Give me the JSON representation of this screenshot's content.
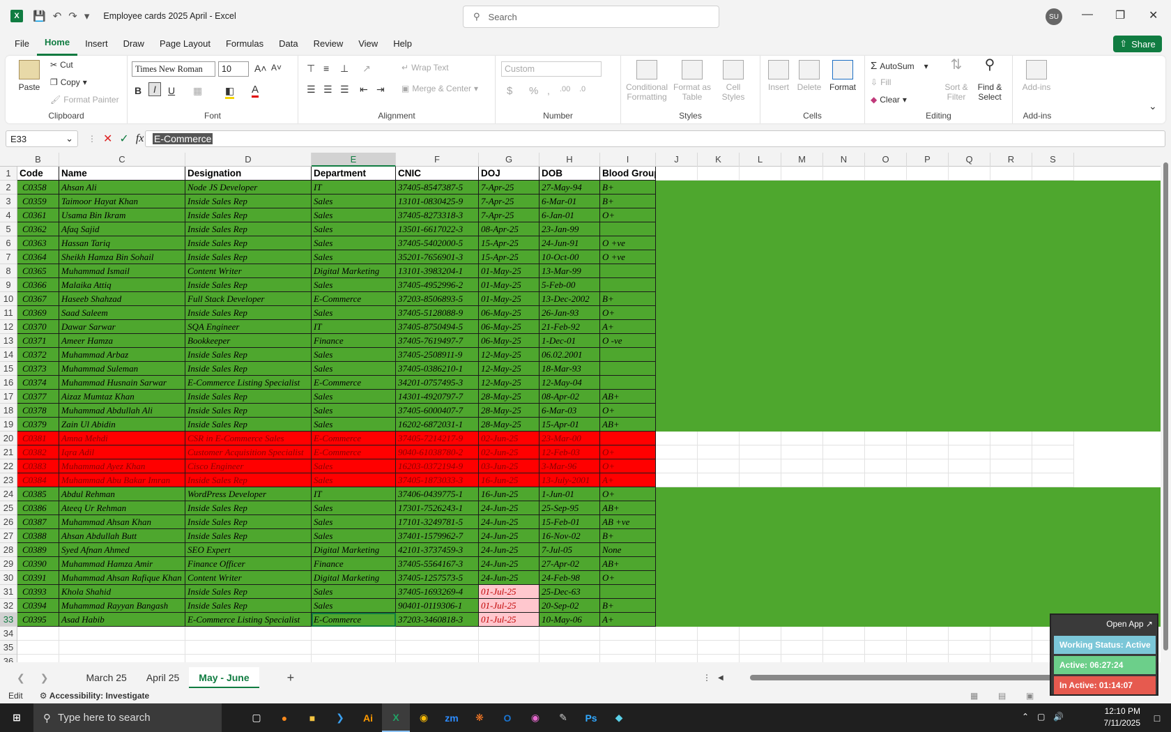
{
  "window": {
    "title": "Employee cards 2025 April  -  Excel",
    "search_placeholder": "Search",
    "avatar": "SU"
  },
  "menu": {
    "items": [
      "File",
      "Home",
      "Insert",
      "Draw",
      "Page Layout",
      "Formulas",
      "Data",
      "Review",
      "View",
      "Help"
    ],
    "share": "Share"
  },
  "ribbon": {
    "clipboard": {
      "paste": "Paste",
      "cut": "Cut",
      "copy": "Copy",
      "format_painter": "Format Painter",
      "label": "Clipboard"
    },
    "font": {
      "name": "Times New Roman",
      "size": "10",
      "label": "Font"
    },
    "alignment": {
      "wrap": "Wrap Text",
      "merge": "Merge & Center",
      "label": "Alignment"
    },
    "number": {
      "format": "Custom",
      "label": "Number"
    },
    "styles": {
      "cond": "Conditional Formatting",
      "table": "Format as Table",
      "cell": "Cell Styles",
      "label": "Styles"
    },
    "cells": {
      "insert": "Insert",
      "delete": "Delete",
      "format": "Format",
      "label": "Cells"
    },
    "editing": {
      "autosum": "AutoSum",
      "fill": "Fill",
      "clear": "Clear",
      "sort": "Sort & Filter",
      "find": "Find & Select",
      "label": "Editing"
    },
    "addins": {
      "btn": "Add-ins",
      "label": "Add-ins"
    }
  },
  "formula": {
    "namebox": "E33",
    "fx": "fx",
    "value": "E-Commerce"
  },
  "grid": {
    "columns": [
      "B",
      "C",
      "D",
      "E",
      "F",
      "G",
      "H",
      "I",
      "J",
      "K",
      "L",
      "M",
      "N",
      "O",
      "P",
      "Q",
      "R",
      "S"
    ],
    "headers": [
      "Code",
      "Name",
      "Designation",
      "Department",
      "CNIC",
      "DOJ",
      "DOB",
      "Blood Group"
    ],
    "rows": [
      [
        "C0358",
        "Ahsan Ali",
        "Node JS Developer",
        "IT",
        "37405-8547387-5",
        "7-Apr-25",
        "27-May-94",
        "B+"
      ],
      [
        "C0359",
        "Taimoor Hayat Khan",
        "Inside Sales Rep",
        "Sales",
        "13101-0830425-9",
        "7-Apr-25",
        "6-Mar-01",
        "B+"
      ],
      [
        "C0361",
        "Usama Bin Ikram",
        "Inside Sales Rep",
        "Sales",
        "37405-8273318-3",
        "7-Apr-25",
        "6-Jan-01",
        "O+"
      ],
      [
        "C0362",
        "Afaq Sajid",
        "Inside Sales Rep",
        "Sales",
        "13501-6617022-3",
        "08-Apr-25",
        "23-Jan-99",
        ""
      ],
      [
        "C0363",
        "Hassan Tariq",
        "Inside Sales Rep",
        "Sales",
        "37405-5402000-5",
        "15-Apr-25",
        "24-Jun-91",
        "O +ve"
      ],
      [
        "C0364",
        "Sheikh Hamza Bin Sohail",
        "Inside Sales Rep",
        "Sales",
        "35201-7656901-3",
        "15-Apr-25",
        "10-Oct-00",
        "O +ve"
      ],
      [
        "C0365",
        "Muhammad Ismail",
        "Content Writer",
        "Digital Marketing",
        "13101-3983204-1",
        "01-May-25",
        "13-Mar-99",
        ""
      ],
      [
        "C0366",
        "Malaika Attiq",
        "Inside Sales Rep",
        "Sales",
        "37405-4952996-2",
        "01-May-25",
        "5-Feb-00",
        ""
      ],
      [
        "C0367",
        "Haseeb Shahzad",
        "Full Stack Developer",
        "E-Commerce",
        "37203-8506893-5",
        "01-May-25",
        "13-Dec-2002",
        "B+"
      ],
      [
        "C0369",
        "Saad Saleem",
        "Inside Sales Rep",
        "Sales",
        "37405-5128088-9",
        "06-May-25",
        "26-Jan-93",
        "O+"
      ],
      [
        "C0370",
        "Dawar Sarwar",
        "SQA Engineer",
        "IT",
        "37405-8750494-5",
        "06-May-25",
        "21-Feb-92",
        "A+"
      ],
      [
        "C0371",
        "Ameer Hamza",
        "Bookkeeper",
        "Finance",
        "37405-7619497-7",
        "06-May-25",
        "1-Dec-01",
        "O -ve"
      ],
      [
        "C0372",
        "Muhammad Arbaz",
        "Inside Sales Rep",
        "Sales",
        "37405-2508911-9",
        "12-May-25",
        "06.02.2001",
        ""
      ],
      [
        "C0373",
        "Muhammad Suleman",
        "Inside Sales Rep",
        "Sales",
        "37405-0386210-1",
        "12-May-25",
        "18-Mar-93",
        ""
      ],
      [
        "C0374",
        "Muhammad Husnain Sarwar",
        "E-Commerce Listing Specialist",
        "E-Commerce",
        "34201-0757495-3",
        "12-May-25",
        "12-May-04",
        ""
      ],
      [
        "C0377",
        "Aizaz Mumtaz Khan",
        "Inside Sales Rep",
        "Sales",
        "14301-4920797-7",
        "28-May-25",
        "08-Apr-02",
        "AB+"
      ],
      [
        "C0378",
        "Muhammad Abdullah Ali",
        "Inside Sales Rep",
        "Sales",
        "37405-6000407-7",
        "28-May-25",
        "6-Mar-03",
        "O+"
      ],
      [
        "C0379",
        "Zain Ul Abidin",
        "Inside Sales Rep",
        "Sales",
        "16202-6872031-1",
        "28-May-25",
        "15-Apr-01",
        "AB+"
      ],
      [
        "C0381",
        "Amna Mehdi",
        "CSR in E-Commerce Sales",
        "E-Commerce",
        "37405-7214217-9",
        "02-Jun-25",
        "23-Mar-00",
        ""
      ],
      [
        "C0382",
        "Iqra Adil",
        "Customer Acquisition Specialist",
        "E-Commerce",
        "9040-61038780-2",
        "02-Jun-25",
        "12-Feb-03",
        "O+"
      ],
      [
        "C0383",
        "Muhammad Ayez Khan",
        "Cisco Engineer",
        "Sales",
        "16203-0372194-9",
        "03-Jun-25",
        "3-Mar-96",
        "O+"
      ],
      [
        "C0384",
        "Muhammad Abu Bakar Imran",
        "Inside Sales Rep",
        "Sales",
        "37405-1873033-3",
        "16-Jun-25",
        "13-July-2001",
        "A+"
      ],
      [
        "C0385",
        "Abdul Rehman",
        "WordPress Developer",
        "IT",
        "37406-0439775-1",
        "16-Jun-25",
        "1-Jun-01",
        "O+"
      ],
      [
        "C0386",
        "Ateeq Ur Rehman",
        "Inside Sales Rep",
        "Sales",
        "17301-7526243-1",
        "24-Jun-25",
        "25-Sep-95",
        "AB+"
      ],
      [
        "C0387",
        "Muhammad Ahsan Khan",
        "Inside Sales Rep",
        "Sales",
        "17101-3249781-5",
        "24-Jun-25",
        "15-Feb-01",
        "AB +ve"
      ],
      [
        "C0388",
        "Ahsan Abdullah Butt",
        "Inside Sales Rep",
        "Sales",
        "37401-1579962-7",
        "24-Jun-25",
        "16-Nov-02",
        "B+"
      ],
      [
        "C0389",
        "Syed Afnan Ahmed",
        "SEO Expert",
        "Digital Marketing",
        "42101-3737459-3",
        "24-Jun-25",
        "7-Jul-05",
        "None"
      ],
      [
        "C0390",
        "Muhammad Hamza Amir",
        "Finance Officer",
        "Finance",
        "37405-5564167-3",
        "24-Jun-25",
        "27-Apr-02",
        "AB+"
      ],
      [
        "C0391",
        "Muhammad Ahsan Rafique Khan",
        "Content Writer",
        "Digital Marketing",
        "37405-1257573-5",
        "24-Jun-25",
        "24-Feb-98",
        "O+"
      ],
      [
        "C0393",
        "Khola Shahid",
        "Inside Sales Rep",
        "Sales",
        "37405-1693269-4",
        "01-Jul-25",
        "25-Dec-63",
        ""
      ],
      [
        "C0394",
        "Muhammad Rayyan Bangash",
        "Inside Sales Rep",
        "Sales",
        "90401-0119306-1",
        "01-Jul-25",
        "20-Sep-02",
        "B+"
      ],
      [
        "C0395",
        "Asad Habib",
        "E-Commerce Listing Specialist",
        "E-Commerce",
        "37203-3460818-3",
        "01-Jul-25",
        "10-May-06",
        "A+"
      ]
    ],
    "red_rows": [
      18,
      19,
      20,
      21
    ],
    "pink_doj_rows": [
      29,
      30,
      31
    ],
    "colors": {
      "green": "#4ea72e",
      "red": "#ff0000",
      "pink": "#ffc7ce"
    }
  },
  "sheets": {
    "tabs": [
      "March 25",
      "April 25",
      "May - June"
    ],
    "active": "May - June"
  },
  "status": {
    "mode": "Edit",
    "accessibility": "Accessibility: Investigate"
  },
  "widget": {
    "open": "Open App ↗",
    "status": "Working Status: Active",
    "active": "Active: 06:27:24",
    "inactive": "In Active: 01:14:07"
  },
  "taskbar": {
    "search": "Type here to search",
    "time": "12:10 PM",
    "date": "7/11/2025"
  }
}
